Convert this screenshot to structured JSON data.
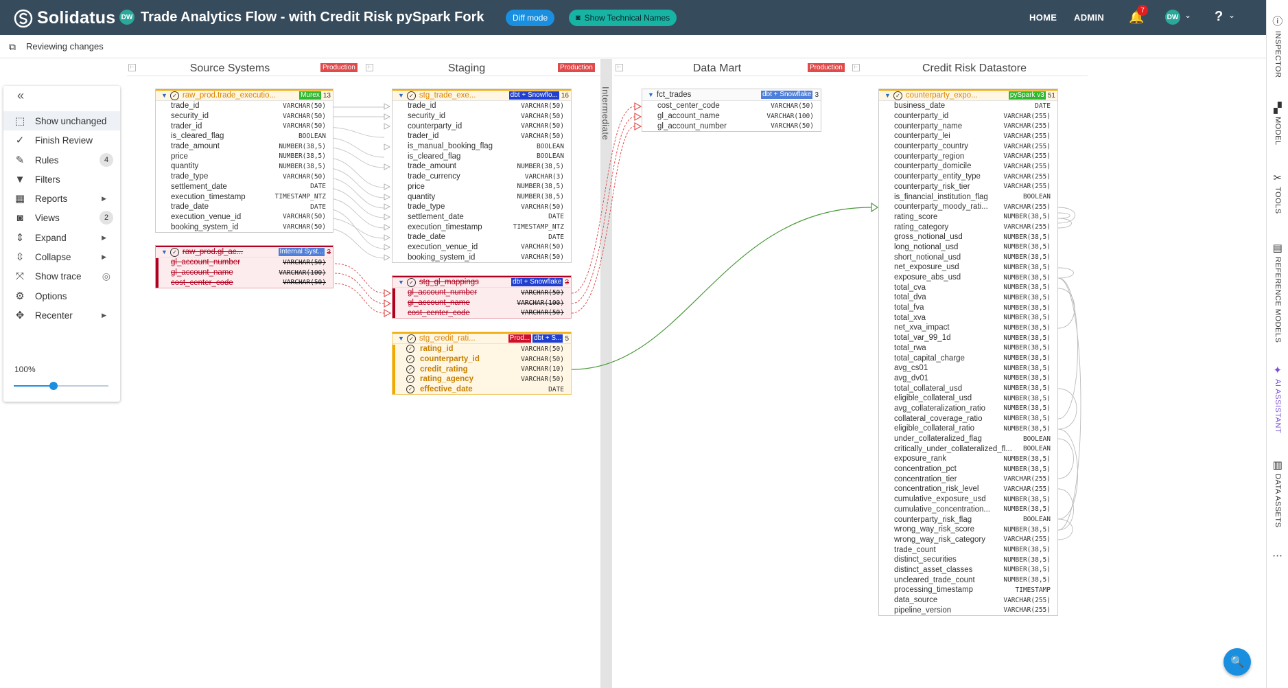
{
  "app": {
    "brand": "Solidatus",
    "user_initials": "DW",
    "model_title": "Trade Analytics Flow - with Credit Risk pySpark Fork"
  },
  "header": {
    "diff_mode": "Diff mode",
    "show_technical_names": "Show Technical Names",
    "home": "HOME",
    "admin": "ADMIN",
    "notification_count": "7",
    "help": "?"
  },
  "review": {
    "label": "Reviewing changes"
  },
  "rail": [
    {
      "label": "INSPECTOR",
      "icon": "inspector-icon"
    },
    {
      "label": "MODEL",
      "icon": "model-icon"
    },
    {
      "label": "TOOLS",
      "icon": "tools-icon"
    },
    {
      "label": "REFERENCE MODELS",
      "icon": "reference-models-icon"
    },
    {
      "label": "AI ASSISTANT",
      "icon": "ai-assistant-icon"
    },
    {
      "label": "DATA ASSETS",
      "icon": "data-assets-icon"
    },
    {
      "label": "...",
      "icon": "more-icon"
    }
  ],
  "columns": [
    {
      "title": "Source Systems",
      "tag": "Production"
    },
    {
      "title": "Staging",
      "tag": "Production"
    },
    {
      "title": "Data Mart",
      "tag": "Production"
    },
    {
      "title": "Credit Risk Datastore",
      "tag": ""
    }
  ],
  "divider_label": "Intermediate",
  "menu": {
    "collapse": "«",
    "items": [
      {
        "label": "Show unchanged",
        "icon": "show-unchanged-icon",
        "count": "",
        "arrow": ""
      },
      {
        "label": "Finish Review",
        "icon": "check-icon",
        "count": "",
        "arrow": ""
      },
      {
        "label": "Rules",
        "icon": "rules-icon",
        "count": "4",
        "arrow": ""
      },
      {
        "label": "Filters",
        "icon": "filter-icon",
        "count": "",
        "arrow": ""
      },
      {
        "label": "Reports",
        "icon": "reports-icon",
        "count": "",
        "arrow": "▶"
      },
      {
        "label": "Views",
        "icon": "camera-icon",
        "count": "2",
        "arrow": ""
      },
      {
        "label": "Expand",
        "icon": "expand-icon",
        "count": "",
        "arrow": "▶"
      },
      {
        "label": "Collapse",
        "icon": "collapse-icon",
        "count": "",
        "arrow": "▶"
      },
      {
        "label": "Show trace",
        "icon": "trace-icon",
        "count": "",
        "arrow": ""
      },
      {
        "label": "Options",
        "icon": "gear-icon",
        "count": "",
        "arrow": ""
      },
      {
        "label": "Recenter",
        "icon": "recenter-icon",
        "count": "",
        "arrow": "▶"
      }
    ],
    "zoom_label": "100%",
    "zoom_fraction": 0.42
  },
  "entities": [
    {
      "id": "raw_exec",
      "name": "raw_prod.trade_executio...",
      "tag": "Murex",
      "tag_color": "#2db82d",
      "count": "13",
      "state": "normal",
      "fields": [
        [
          "trade_id",
          "VARCHAR(50)"
        ],
        [
          "security_id",
          "VARCHAR(50)"
        ],
        [
          "trader_id",
          "VARCHAR(50)"
        ],
        [
          "is_cleared_flag",
          "BOOLEAN"
        ],
        [
          "trade_amount",
          "NUMBER(38,5)"
        ],
        [
          "price",
          "NUMBER(38,5)"
        ],
        [
          "quantity",
          "NUMBER(38,5)"
        ],
        [
          "trade_type",
          "VARCHAR(50)"
        ],
        [
          "settlement_date",
          "DATE"
        ],
        [
          "execution_timestamp",
          "TIMESTAMP_NTZ"
        ],
        [
          "trade_date",
          "DATE"
        ],
        [
          "execution_venue_id",
          "VARCHAR(50)"
        ],
        [
          "booking_system_id",
          "VARCHAR(50)"
        ]
      ]
    },
    {
      "id": "raw_gl",
      "name": "raw_prod.gl_ac...",
      "tag": "Internal Syst...",
      "tag_color": "#4f7fd8",
      "count": "3",
      "state": "deleted",
      "fields": [
        [
          "gl_account_number",
          "VARCHAR(50)"
        ],
        [
          "gl_account_name",
          "VARCHAR(100)"
        ],
        [
          "cost_center_code",
          "VARCHAR(50)"
        ]
      ]
    },
    {
      "id": "stg_trade",
      "name": "stg_trade_exe...",
      "tag": "dbt + Snowflo...",
      "tag_color": "#1f3fd0",
      "count": "16",
      "state": "normal",
      "fields": [
        [
          "trade_id",
          "VARCHAR(50)"
        ],
        [
          "security_id",
          "VARCHAR(50)"
        ],
        [
          "counterparty_id",
          "VARCHAR(50)"
        ],
        [
          "trader_id",
          "VARCHAR(50)"
        ],
        [
          "is_manual_booking_flag",
          "BOOLEAN"
        ],
        [
          "is_cleared_flag",
          "BOOLEAN"
        ],
        [
          "trade_amount",
          "NUMBER(38,5)"
        ],
        [
          "trade_currency",
          "VARCHAR(3)"
        ],
        [
          "price",
          "NUMBER(38,5)"
        ],
        [
          "quantity",
          "NUMBER(38,5)"
        ],
        [
          "trade_type",
          "VARCHAR(50)"
        ],
        [
          "settlement_date",
          "DATE"
        ],
        [
          "execution_timestamp",
          "TIMESTAMP_NTZ"
        ],
        [
          "trade_date",
          "DATE"
        ],
        [
          "execution_venue_id",
          "VARCHAR(50)"
        ],
        [
          "booking_system_id",
          "VARCHAR(50)"
        ]
      ]
    },
    {
      "id": "stg_gl",
      "name": "stg_gl_mappings",
      "tag": "dbt + Snowflake",
      "tag_color": "#1f3fd0",
      "count": "3",
      "state": "deleted",
      "fields": [
        [
          "gl_account_number",
          "VARCHAR(50)"
        ],
        [
          "gl_account_name",
          "VARCHAR(100)"
        ],
        [
          "cost_center_code",
          "VARCHAR(50)"
        ]
      ]
    },
    {
      "id": "stg_credit",
      "name": "stg_credit_rati...",
      "tag": "Prod...",
      "tag_color": "#d0102a",
      "tag2": "dbt + S...",
      "tag2_color": "#1f3fd0",
      "count": "5",
      "state": "added",
      "fields": [
        [
          "rating_id",
          "VARCHAR(50)"
        ],
        [
          "counterparty_id",
          "VARCHAR(50)"
        ],
        [
          "credit_rating",
          "VARCHAR(10)"
        ],
        [
          "rating_agency",
          "VARCHAR(50)"
        ],
        [
          "effective_date",
          "DATE"
        ]
      ]
    },
    {
      "id": "fct_trades",
      "name": "fct_trades",
      "tag": "dbt + Snowflake",
      "tag_color": "#4f7fd8",
      "count": "3",
      "state": "plain",
      "fields": [
        [
          "cost_center_code",
          "VARCHAR(50)"
        ],
        [
          "gl_account_name",
          "VARCHAR(100)"
        ],
        [
          "gl_account_number",
          "VARCHAR(50)"
        ]
      ]
    },
    {
      "id": "cpty",
      "name": "counterparty_expo...",
      "tag": "pySpark v3",
      "tag_color": "#2db82d",
      "count": "51",
      "state": "normal",
      "fields": [
        [
          "business_date",
          "DATE"
        ],
        [
          "counterparty_id",
          "VARCHAR(255)"
        ],
        [
          "counterparty_name",
          "VARCHAR(255)"
        ],
        [
          "counterparty_lei",
          "VARCHAR(255)"
        ],
        [
          "counterparty_country",
          "VARCHAR(255)"
        ],
        [
          "counterparty_region",
          "VARCHAR(255)"
        ],
        [
          "counterparty_domicile",
          "VARCHAR(255)"
        ],
        [
          "counterparty_entity_type",
          "VARCHAR(255)"
        ],
        [
          "counterparty_risk_tier",
          "VARCHAR(255)"
        ],
        [
          "is_financial_institution_flag",
          "BOOLEAN"
        ],
        [
          "counterparty_moody_rati...",
          "VARCHAR(255)"
        ],
        [
          "rating_score",
          "NUMBER(38,5)"
        ],
        [
          "rating_category",
          "VARCHAR(255)"
        ],
        [
          "gross_notional_usd",
          "NUMBER(38,5)"
        ],
        [
          "long_notional_usd",
          "NUMBER(38,5)"
        ],
        [
          "short_notional_usd",
          "NUMBER(38,5)"
        ],
        [
          "net_exposure_usd",
          "NUMBER(38,5)"
        ],
        [
          "exposure_abs_usd",
          "NUMBER(38,5)"
        ],
        [
          "total_cva",
          "NUMBER(38,5)"
        ],
        [
          "total_dva",
          "NUMBER(38,5)"
        ],
        [
          "total_fva",
          "NUMBER(38,5)"
        ],
        [
          "total_xva",
          "NUMBER(38,5)"
        ],
        [
          "net_xva_impact",
          "NUMBER(38,5)"
        ],
        [
          "total_var_99_1d",
          "NUMBER(38,5)"
        ],
        [
          "total_rwa",
          "NUMBER(38,5)"
        ],
        [
          "total_capital_charge",
          "NUMBER(38,5)"
        ],
        [
          "avg_cs01",
          "NUMBER(38,5)"
        ],
        [
          "avg_dv01",
          "NUMBER(38,5)"
        ],
        [
          "total_collateral_usd",
          "NUMBER(38,5)"
        ],
        [
          "eligible_collateral_usd",
          "NUMBER(38,5)"
        ],
        [
          "avg_collateralization_ratio",
          "NUMBER(38,5)"
        ],
        [
          "collateral_coverage_ratio",
          "NUMBER(38,5)"
        ],
        [
          "eligible_collateral_ratio",
          "NUMBER(38,5)"
        ],
        [
          "under_collateralized_flag",
          "BOOLEAN"
        ],
        [
          "critically_under_collateralized_fl...",
          "BOOLEAN"
        ],
        [
          "exposure_rank",
          "NUMBER(38,5)"
        ],
        [
          "concentration_pct",
          "NUMBER(38,5)"
        ],
        [
          "concentration_tier",
          "VARCHAR(255)"
        ],
        [
          "concentration_risk_level",
          "VARCHAR(255)"
        ],
        [
          "cumulative_exposure_usd",
          "NUMBER(38,5)"
        ],
        [
          "cumulative_concentration...",
          "NUMBER(38,5)"
        ],
        [
          "counterparty_risk_flag",
          "BOOLEAN"
        ],
        [
          "wrong_way_risk_score",
          "NUMBER(38,5)"
        ],
        [
          "wrong_way_risk_category",
          "VARCHAR(255)"
        ],
        [
          "trade_count",
          "NUMBER(38,5)"
        ],
        [
          "distinct_securities",
          "NUMBER(38,5)"
        ],
        [
          "distinct_asset_classes",
          "NUMBER(38,5)"
        ],
        [
          "uncleared_trade_count",
          "NUMBER(38,5)"
        ],
        [
          "processing_timestamp",
          "TIMESTAMP"
        ],
        [
          "data_source",
          "VARCHAR(255)"
        ],
        [
          "pipeline_version",
          "VARCHAR(255)"
        ]
      ]
    }
  ],
  "colors": {
    "topbar": "#364b5c",
    "accent": "#1a8fe0",
    "production": "#e04a4a",
    "deleted": "#b00020",
    "added": "#f2a900",
    "lineage": "#4a9a3a"
  }
}
